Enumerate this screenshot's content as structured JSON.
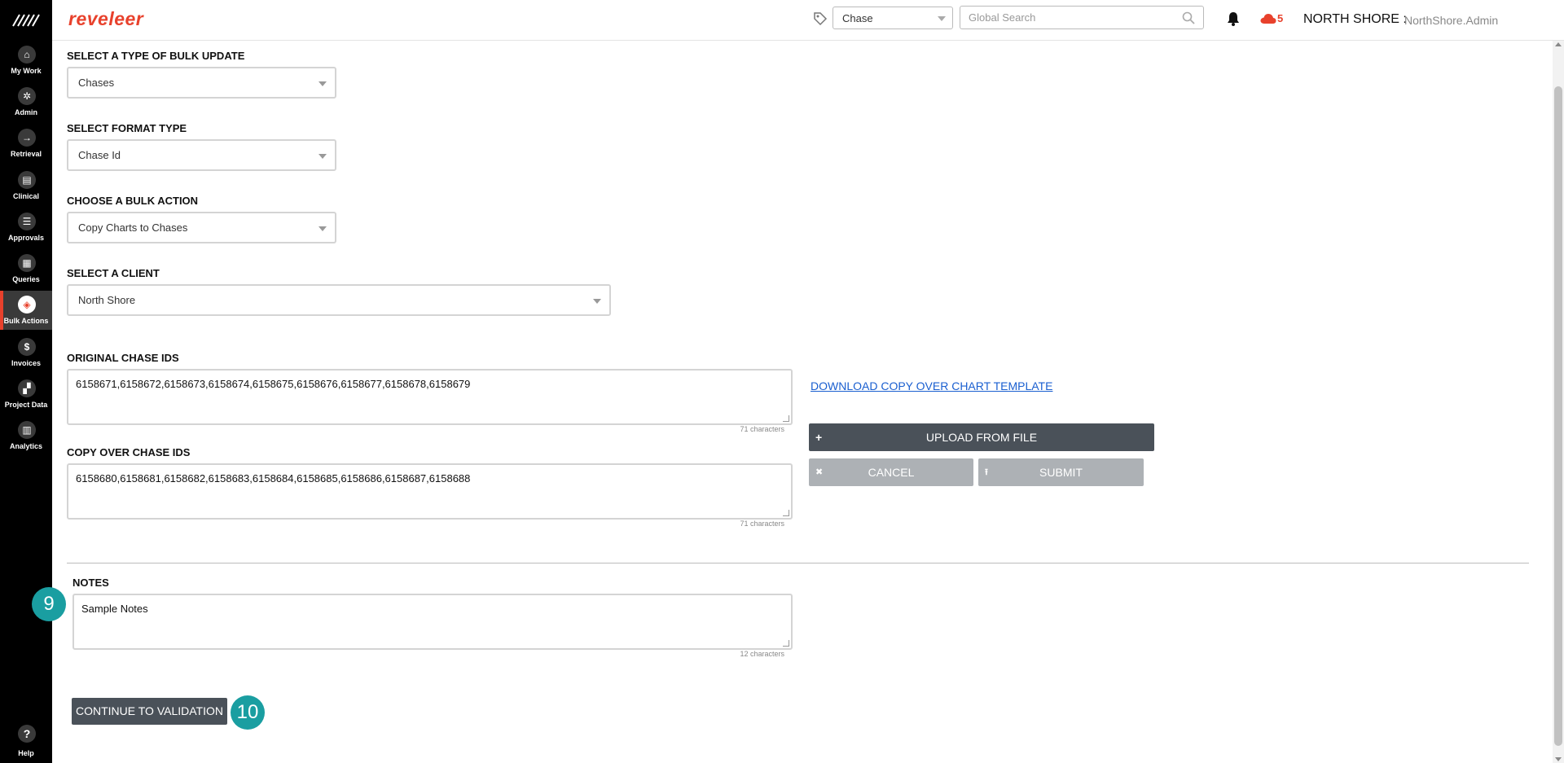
{
  "app": {
    "brand": "reveleer"
  },
  "sidebar": {
    "items": [
      {
        "label": "My Work",
        "icon": "home-icon",
        "glyph": "⌂"
      },
      {
        "label": "Admin",
        "icon": "gear-icon",
        "glyph": "✲"
      },
      {
        "label": "Retrieval",
        "icon": "arrow-right-icon",
        "glyph": "→"
      },
      {
        "label": "Clinical",
        "icon": "clipboard-icon",
        "glyph": "▤"
      },
      {
        "label": "Approvals",
        "icon": "checklist-icon",
        "glyph": "☰"
      },
      {
        "label": "Queries",
        "icon": "list-icon",
        "glyph": "▦"
      },
      {
        "label": "Bulk Actions",
        "icon": "layers-icon",
        "glyph": "◈"
      },
      {
        "label": "Invoices",
        "icon": "dollar-icon",
        "glyph": "$"
      },
      {
        "label": "Project Data",
        "icon": "grid-icon",
        "glyph": "▞"
      },
      {
        "label": "Analytics",
        "icon": "bar-chart-icon",
        "glyph": "▥"
      }
    ],
    "help_label": "Help",
    "help_glyph": "?"
  },
  "header": {
    "entity_select": "Chase",
    "search_placeholder": "Global Search",
    "alerts_count": "5",
    "org": "NORTH SHORE :",
    "user": "NorthShore.Admin"
  },
  "form": {
    "bulk_update_label": "SELECT A TYPE OF BULK UPDATE",
    "bulk_update_value": "Chases",
    "format_type_label": "SELECT FORMAT TYPE",
    "format_type_value": "Chase Id",
    "bulk_action_label": "CHOOSE A BULK ACTION",
    "bulk_action_value": "Copy Charts to Chases",
    "client_label": "SELECT A CLIENT",
    "client_value": "North Shore",
    "original_ids_label": "ORIGINAL CHASE IDS",
    "original_ids_value": "6158671,6158672,6158673,6158674,6158675,6158676,6158677,6158678,6158679",
    "original_ids_chars": "71 characters",
    "copy_ids_label": "COPY OVER CHASE IDS",
    "copy_ids_value": "6158680,6158681,6158682,6158683,6158684,6158685,6158686,6158687,6158688",
    "copy_ids_chars": "71 characters",
    "download_link": "DOWNLOAD COPY OVER CHART TEMPLATE",
    "upload_button": "UPLOAD FROM FILE",
    "cancel_button": "CANCEL",
    "submit_button": "SUBMIT",
    "notes_label": "NOTES",
    "notes_value": "Sample Notes",
    "notes_chars": "12 characters",
    "continue_button": "CONTINUE TO VALIDATION"
  },
  "callouts": {
    "notes_step": "9",
    "continue_step": "10"
  },
  "colors": {
    "brand": "#e8412c",
    "callout": "#1a9ea1",
    "dark_button": "#4a5159",
    "disabled_button": "#adb1b5",
    "link": "#1a5fd0"
  }
}
